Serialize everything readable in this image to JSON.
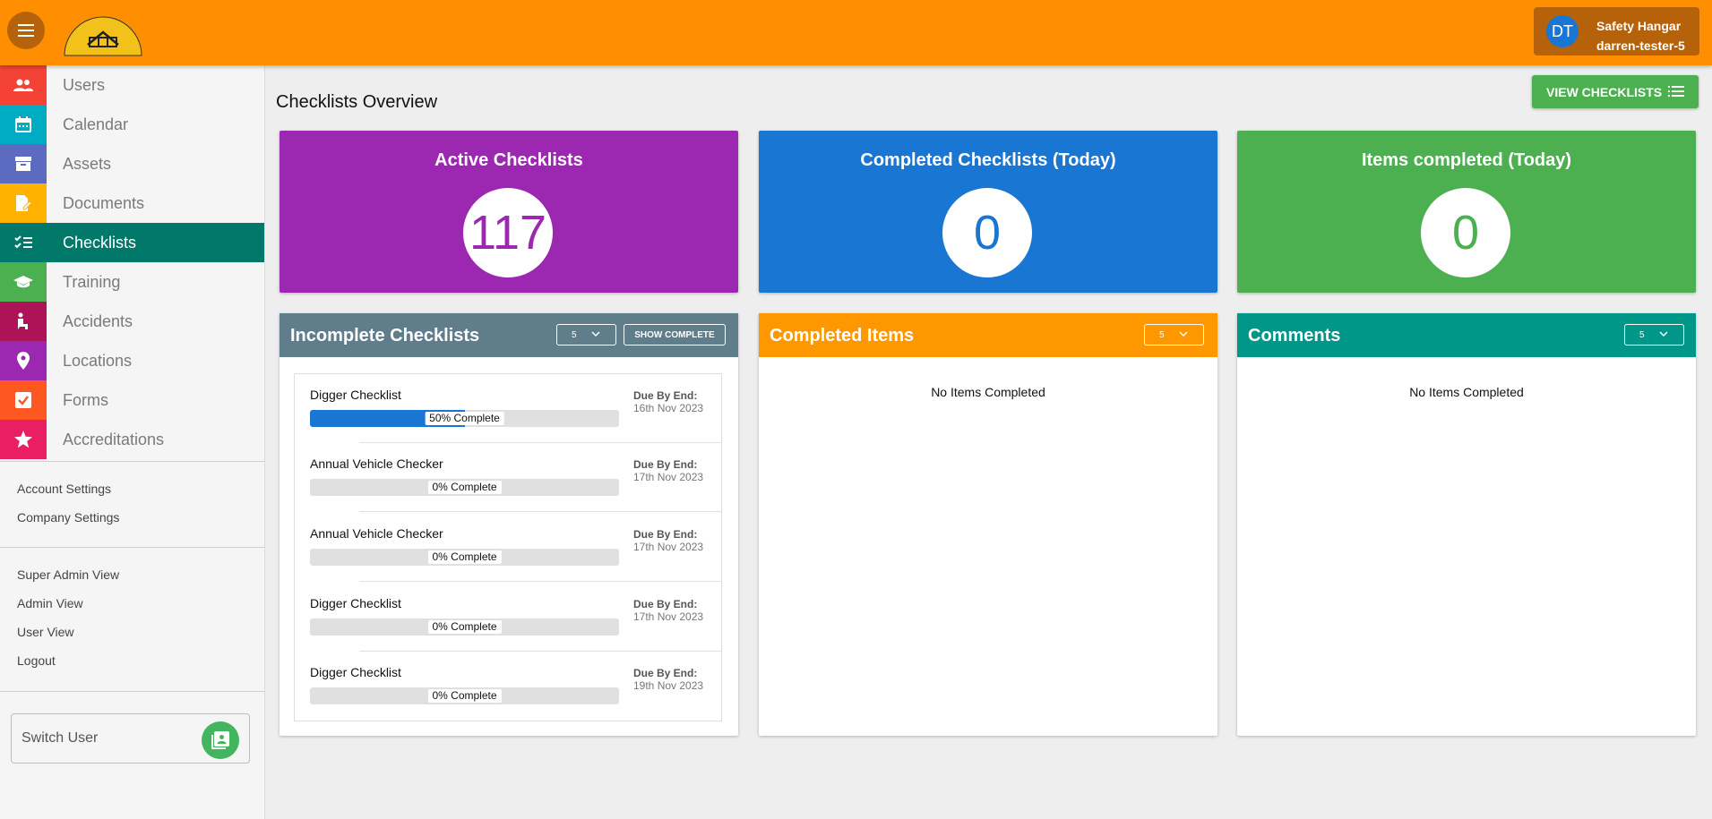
{
  "header": {
    "logo_text": "SAFETY HANGAR",
    "user": {
      "initials": "DT",
      "company": "Safety Hangar",
      "username": "darren-tester-5"
    }
  },
  "sidebar": {
    "nav": [
      {
        "label": "Users",
        "icon": "users-icon",
        "color": "#f44336"
      },
      {
        "label": "Calendar",
        "icon": "calendar-icon",
        "color": "#00acc1"
      },
      {
        "label": "Assets",
        "icon": "archive-icon",
        "color": "#5c6bc0"
      },
      {
        "label": "Documents",
        "icon": "document-edit-icon",
        "color": "#ffb300"
      },
      {
        "label": "Checklists",
        "icon": "checklist-icon",
        "color": "#00796b"
      },
      {
        "label": "Training",
        "icon": "graduation-cap-icon",
        "color": "#4caf50"
      },
      {
        "label": "Accidents",
        "icon": "injured-person-icon",
        "color": "#ad1457"
      },
      {
        "label": "Locations",
        "icon": "location-pin-icon",
        "color": "#9c27b0"
      },
      {
        "label": "Forms",
        "icon": "checkbox-icon",
        "color": "#ff5722"
      },
      {
        "label": "Accreditations",
        "icon": "star-icon",
        "color": "#e91e63"
      }
    ],
    "settings_links": [
      "Account Settings",
      "Company Settings"
    ],
    "view_links": [
      "Super Admin View",
      "Admin View",
      "User View",
      "Logout"
    ],
    "switch_user": "Switch User"
  },
  "main": {
    "title": "Checklists Overview",
    "view_button": "VIEW CHECKLISTS",
    "stats": [
      {
        "title": "Active Checklists",
        "value": "117",
        "color": "#9c27b0"
      },
      {
        "title": "Completed Checklists (Today)",
        "value": "0",
        "color": "#1976d2"
      },
      {
        "title": "Items completed (Today)",
        "value": "0",
        "color": "#4caf50"
      }
    ],
    "incomplete": {
      "title": "Incomplete Checklists",
      "page_size": "5",
      "show_complete": "SHOW COMPLETE",
      "color": "#607d8b",
      "items": [
        {
          "name": "Digger Checklist",
          "progress_pct": 50,
          "progress_label": "50% Complete",
          "due_label": "Due By End:",
          "due_date": "16th Nov 2023"
        },
        {
          "name": "Annual Vehicle Checker",
          "progress_pct": 0,
          "progress_label": "0% Complete",
          "due_label": "Due By End:",
          "due_date": "17th Nov 2023"
        },
        {
          "name": "Annual Vehicle Checker",
          "progress_pct": 0,
          "progress_label": "0% Complete",
          "due_label": "Due By End:",
          "due_date": "17th Nov 2023"
        },
        {
          "name": "Digger Checklist",
          "progress_pct": 0,
          "progress_label": "0% Complete",
          "due_label": "Due By End:",
          "due_date": "17th Nov 2023"
        },
        {
          "name": "Digger Checklist",
          "progress_pct": 0,
          "progress_label": "0% Complete",
          "due_label": "Due By End:",
          "due_date": "19th Nov 2023"
        }
      ]
    },
    "completed_items": {
      "title": "Completed Items",
      "page_size": "5",
      "empty": "No Items Completed",
      "color": "#ff9800"
    },
    "comments": {
      "title": "Comments",
      "page_size": "5",
      "empty": "No Items Completed",
      "color": "#009688"
    }
  }
}
